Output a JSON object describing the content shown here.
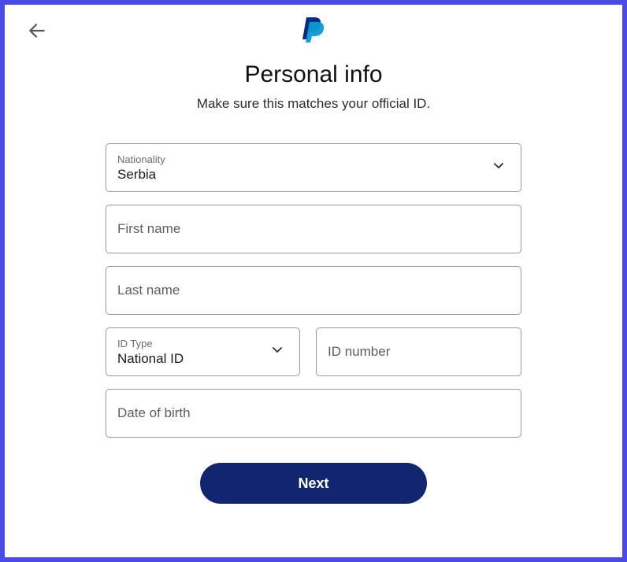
{
  "header": {
    "title": "Personal info",
    "subtitle": "Make sure this matches your official ID."
  },
  "fields": {
    "nationality": {
      "label": "Nationality",
      "value": "Serbia"
    },
    "first_name": {
      "placeholder": "First name"
    },
    "last_name": {
      "placeholder": "Last name"
    },
    "id_type": {
      "label": "ID Type",
      "value": "National ID"
    },
    "id_number": {
      "placeholder": "ID number"
    },
    "dob": {
      "placeholder": "Date of birth"
    }
  },
  "actions": {
    "next": "Next"
  }
}
